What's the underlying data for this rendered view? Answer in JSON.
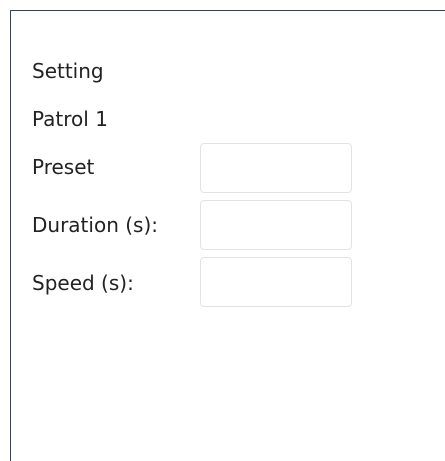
{
  "panel": {
    "title": "Setting",
    "subtitle": "Patrol 1",
    "fields": [
      {
        "label": "Preset",
        "value": ""
      },
      {
        "label": "Duration (s):",
        "value": ""
      },
      {
        "label": "Speed (s):",
        "value": ""
      }
    ]
  },
  "colors": {
    "border": "#3a4250",
    "input_border": "#e3e3e3",
    "text": "#222222"
  }
}
